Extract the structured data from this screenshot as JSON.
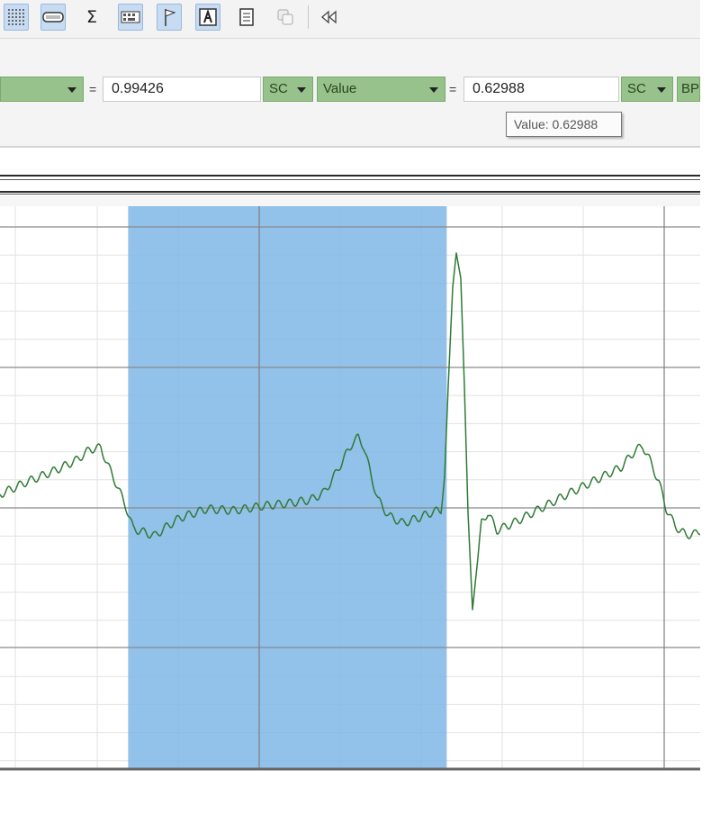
{
  "toolbar": {
    "buttons": [
      {
        "name": "grid-icon",
        "active": true
      },
      {
        "name": "ruler-icon",
        "active": true
      },
      {
        "name": "sum-icon",
        "active": false
      },
      {
        "name": "keyboard-icon",
        "active": true
      },
      {
        "name": "flag-icon",
        "active": true
      },
      {
        "name": "text-annotation-icon",
        "active": true
      },
      {
        "name": "notes-icon",
        "active": false
      },
      {
        "name": "copy-icon",
        "active": false
      },
      {
        "name": "collapse-left-icon",
        "active": false
      }
    ]
  },
  "measurement": {
    "left_value": "0.99426",
    "left_unit": "SC",
    "right_label": "Value",
    "right_value": "0.62988",
    "right_unit": "SC",
    "cutoff_label": "BP",
    "equals": "=",
    "tooltip": "Value: 0.62988"
  },
  "colors": {
    "trace": "#2f7a35",
    "selection": "#7fb6e6",
    "dropdown": "#97c28b"
  },
  "selection": {
    "start_fraction": 0.183,
    "end_fraction": 0.638
  }
}
